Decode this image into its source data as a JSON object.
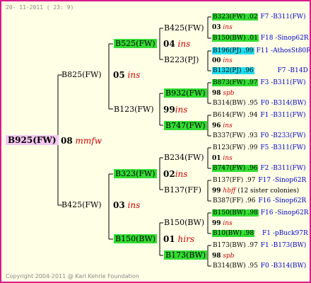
{
  "date_stamp": "20- 11-2011 ( 23: 9)",
  "copyright": "Copyright 2004-2011 @ Karl Kehrle Foundation",
  "root": {
    "name": "B925(FW)",
    "gen": "08",
    "mark": "mmfw"
  },
  "g1": [
    {
      "name": "B825(FW)",
      "gen": "05",
      "mark": "ins"
    },
    {
      "name": "B425(FW)",
      "gen": "03",
      "mark": "ins"
    }
  ],
  "g2": [
    {
      "name": "B525(FW)",
      "gen": "04",
      "mark": "ins"
    },
    {
      "name": "B123(FW)",
      "gen": "99",
      "mark": "ins"
    },
    {
      "name": "B323(FW)",
      "gen": "02",
      "mark": "ins"
    },
    {
      "name": "B150(BW)",
      "gen": "01",
      "mark": "hirs"
    }
  ],
  "g3": [
    {
      "name": "B425(FW)",
      "gen": "04",
      "mark": "ins"
    },
    {
      "name": "B223(PJ)",
      "gen": "00",
      "mark": ""
    },
    {
      "name": "B932(FW)",
      "gen": "98",
      "mark": ""
    },
    {
      "name": "B747(FW)",
      "gen": "",
      "mark": ""
    },
    {
      "name": "B234(FW)",
      "gen": "",
      "mark": ""
    },
    {
      "name": "B137(FF)",
      "gen": "",
      "mark": ""
    },
    {
      "name": "B150(BW)",
      "gen": "",
      "mark": ""
    },
    {
      "name": "B173(BW)",
      "gen": "",
      "mark": ""
    }
  ],
  "g4": [
    {
      "code": "B323(FW) .02",
      "right": "F7 -B311(FW)"
    },
    {
      "gen": "03",
      "mark": "ins"
    },
    {
      "code": "B150(BW) .01",
      "right": "F18 -Sinop62R"
    },
    {
      "code": "B196(PJ) .99",
      "right": "F11 -AthosSt80R"
    },
    {
      "gen": "00",
      "mark": "ins"
    },
    {
      "code": "B132(PJ) .96",
      "right": "F7 -B14D"
    },
    {
      "code": "B873(FW) .97",
      "right": "F3 -B311(FW)"
    },
    {
      "gen": "98",
      "mark": "spb"
    },
    {
      "code": "B314(BW) .95",
      "right": "F0 -B314(BW)"
    },
    {
      "code": "B614(FW) .94",
      "right": "F1 -B311(FW)"
    },
    {
      "gen": "96",
      "mark": "ins"
    },
    {
      "code": "B337(FW) .93",
      "right": "F0 -B233(FW)"
    },
    {
      "code": "B123(FW) .99",
      "right": "F5 -B311(FW)"
    },
    {
      "gen": "01",
      "mark": "ins"
    },
    {
      "code": "B747(FW) .96",
      "right": "F2 -B311(FW)"
    },
    {
      "code": "B137(FF) .97",
      "right": "F17 -Sinop62R"
    },
    {
      "gen": "99",
      "mark": "hbff",
      "note": "(12 sister colonies)"
    },
    {
      "code": "B387(FF) .96",
      "right": "F16 -Sinop62R"
    },
    {
      "code": "B150(BW) .98",
      "right": "F16 -Sinop62R"
    },
    {
      "gen": "99",
      "mark": "ins"
    },
    {
      "code": "B10(BW) .98",
      "right": "F1 -pBuck97R"
    },
    {
      "code": "B173(BW) .97",
      "right": "F1 -B173(BW)"
    },
    {
      "gen": "98",
      "mark": "spb"
    },
    {
      "code": "B314(BW) .95",
      "right": "F0 -B314(BW)"
    }
  ]
}
